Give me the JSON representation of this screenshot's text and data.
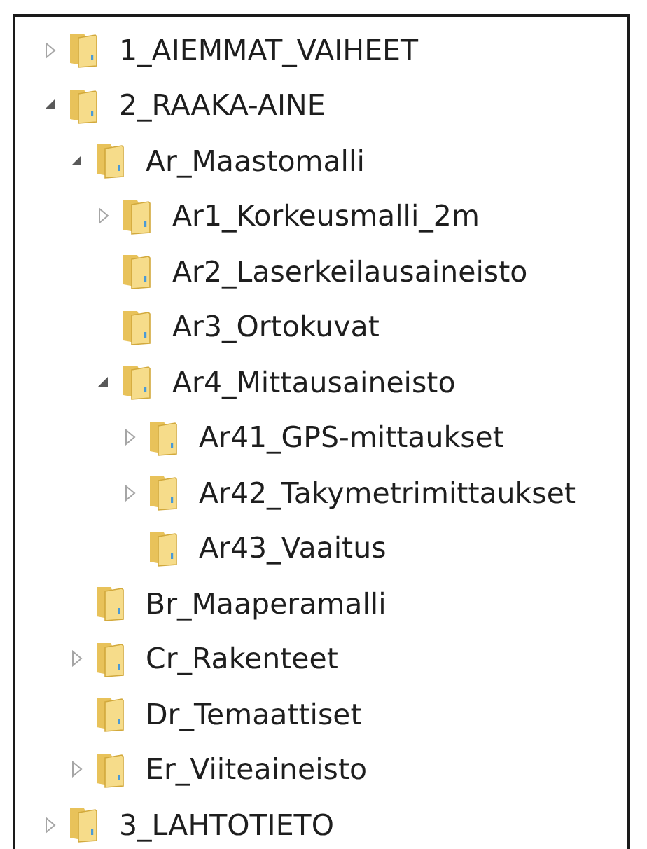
{
  "tree": [
    {
      "label": "1_AIEMMAT_VAIHEET",
      "expandable": true,
      "expanded": false
    },
    {
      "label": "2_RAAKA-AINE",
      "expandable": true,
      "expanded": true,
      "children": [
        {
          "label": "Ar_Maastomalli",
          "expandable": true,
          "expanded": true,
          "children": [
            {
              "label": "Ar1_Korkeusmalli_2m",
              "expandable": true,
              "expanded": false
            },
            {
              "label": "Ar2_Laserkeilausaineisto",
              "expandable": false,
              "expanded": false
            },
            {
              "label": "Ar3_Ortokuvat",
              "expandable": false,
              "expanded": false
            },
            {
              "label": "Ar4_Mittausaineisto",
              "expandable": true,
              "expanded": true,
              "children": [
                {
                  "label": "Ar41_GPS-mittaukset",
                  "expandable": true,
                  "expanded": false
                },
                {
                  "label": "Ar42_Takymetrimittaukset",
                  "expandable": true,
                  "expanded": false
                },
                {
                  "label": "Ar43_Vaaitus",
                  "expandable": false,
                  "expanded": false
                }
              ]
            }
          ]
        },
        {
          "label": "Br_Maaperamalli",
          "expandable": false,
          "expanded": false
        },
        {
          "label": "Cr_Rakenteet",
          "expandable": true,
          "expanded": false
        },
        {
          "label": "Dr_Temaattiset",
          "expandable": false,
          "expanded": false
        },
        {
          "label": "Er_Viiteaineisto",
          "expandable": true,
          "expanded": false
        }
      ]
    },
    {
      "label": "3_LAHTOTIETO",
      "expandable": true,
      "expanded": false
    }
  ]
}
